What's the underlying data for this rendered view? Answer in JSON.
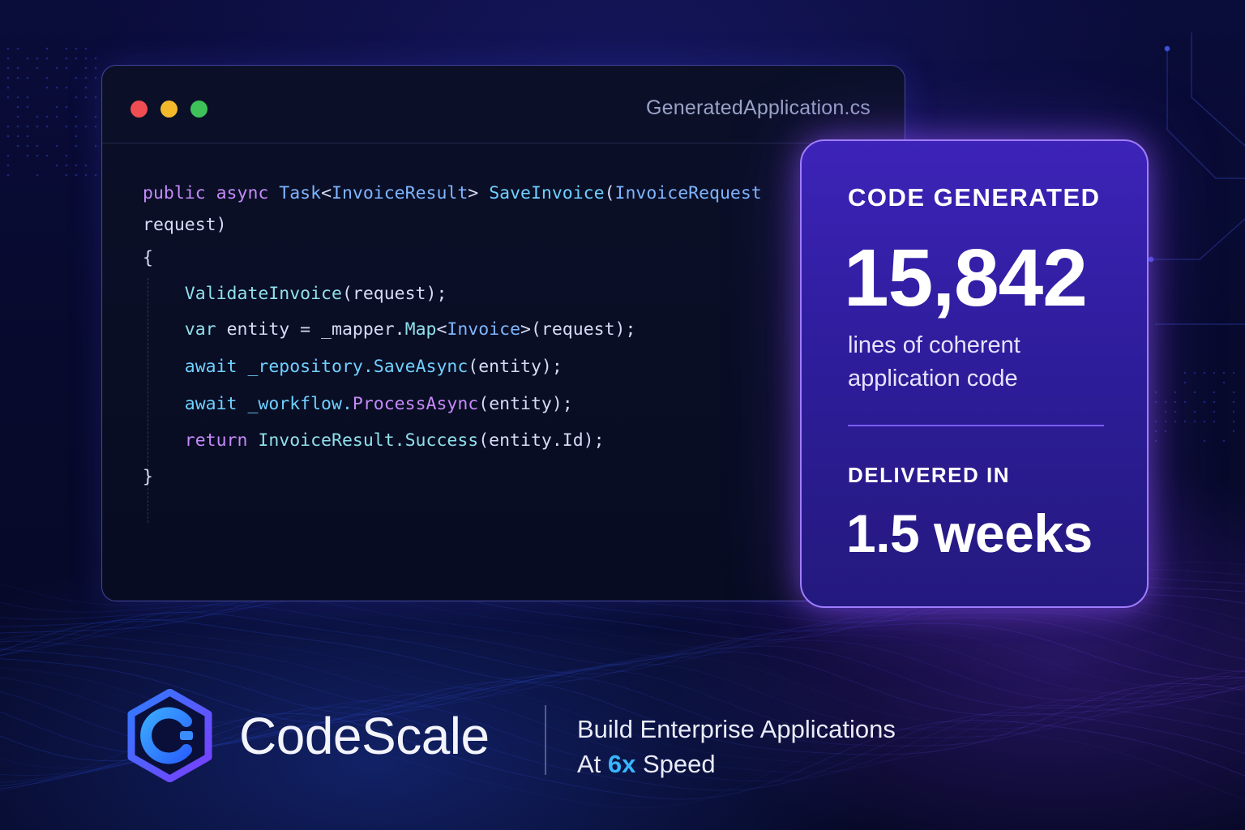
{
  "window": {
    "filename": "GeneratedApplication.cs"
  },
  "code_lines": [
    [
      {
        "t": "public async ",
        "c": "kw"
      },
      {
        "t": "Task",
        "c": "ty"
      },
      {
        "t": "<",
        "c": "tx"
      },
      {
        "t": "InvoiceResult",
        "c": "ty"
      },
      {
        "t": "> ",
        "c": "tx"
      },
      {
        "t": "SaveInvoice",
        "c": "fn"
      },
      {
        "t": "(",
        "c": "tx"
      },
      {
        "t": "InvoiceRequest",
        "c": "ty"
      }
    ],
    [
      {
        "t": "request",
        "c": "tx"
      },
      {
        "t": ")",
        "c": "tx"
      }
    ],
    [
      {
        "t": "{",
        "c": "tx"
      }
    ],
    [
      {
        "t": "    ",
        "c": "tx"
      },
      {
        "t": "ValidateInvoice",
        "c": "ac"
      },
      {
        "t": "(request);",
        "c": "tx"
      }
    ],
    [
      {
        "t": "    ",
        "c": "tx"
      },
      {
        "t": "var ",
        "c": "ac"
      },
      {
        "t": "entity = _mapper.",
        "c": "tx"
      },
      {
        "t": "Map",
        "c": "ac"
      },
      {
        "t": "<",
        "c": "tx"
      },
      {
        "t": "Invoice",
        "c": "ty"
      },
      {
        "t": ">(request);",
        "c": "tx"
      }
    ],
    [
      {
        "t": "    ",
        "c": "tx"
      },
      {
        "t": "await ",
        "c": "fn"
      },
      {
        "t": "_repository.",
        "c": "fn"
      },
      {
        "t": "SaveAsync",
        "c": "fn"
      },
      {
        "t": "(entity);",
        "c": "tx"
      }
    ],
    [
      {
        "t": "    ",
        "c": "tx"
      },
      {
        "t": "await ",
        "c": "fn"
      },
      {
        "t": "_workflow.",
        "c": "fn"
      },
      {
        "t": "ProcessAsync",
        "c": "kw"
      },
      {
        "t": "(entity);",
        "c": "tx"
      }
    ],
    [
      {
        "t": "    ",
        "c": "tx"
      },
      {
        "t": "return ",
        "c": "kw"
      },
      {
        "t": "InvoiceResult.",
        "c": "ac"
      },
      {
        "t": "Success",
        "c": "ac"
      },
      {
        "t": "(entity.Id);",
        "c": "tx"
      }
    ],
    [
      {
        "t": "}",
        "c": "tx"
      }
    ]
  ],
  "stats": {
    "code_label": "CODE GENERATED",
    "lines_count": "15,842",
    "lines_desc": "lines of coherent application code",
    "delivered_label": "DELIVERED IN",
    "delivered_value": "1.5 weeks"
  },
  "brand": {
    "name": "CodeScale",
    "tagline_line1": "Build Enterprise Applications",
    "tagline_prefix": "At ",
    "tagline_speed": "6x",
    "tagline_suffix": " Speed"
  },
  "colors": {
    "accent_purple": "#a07dff",
    "speed_blue": "#37b7ff",
    "keyword": "#c58af9",
    "type": "#7fb5ff",
    "function": "#6fd0ff"
  }
}
